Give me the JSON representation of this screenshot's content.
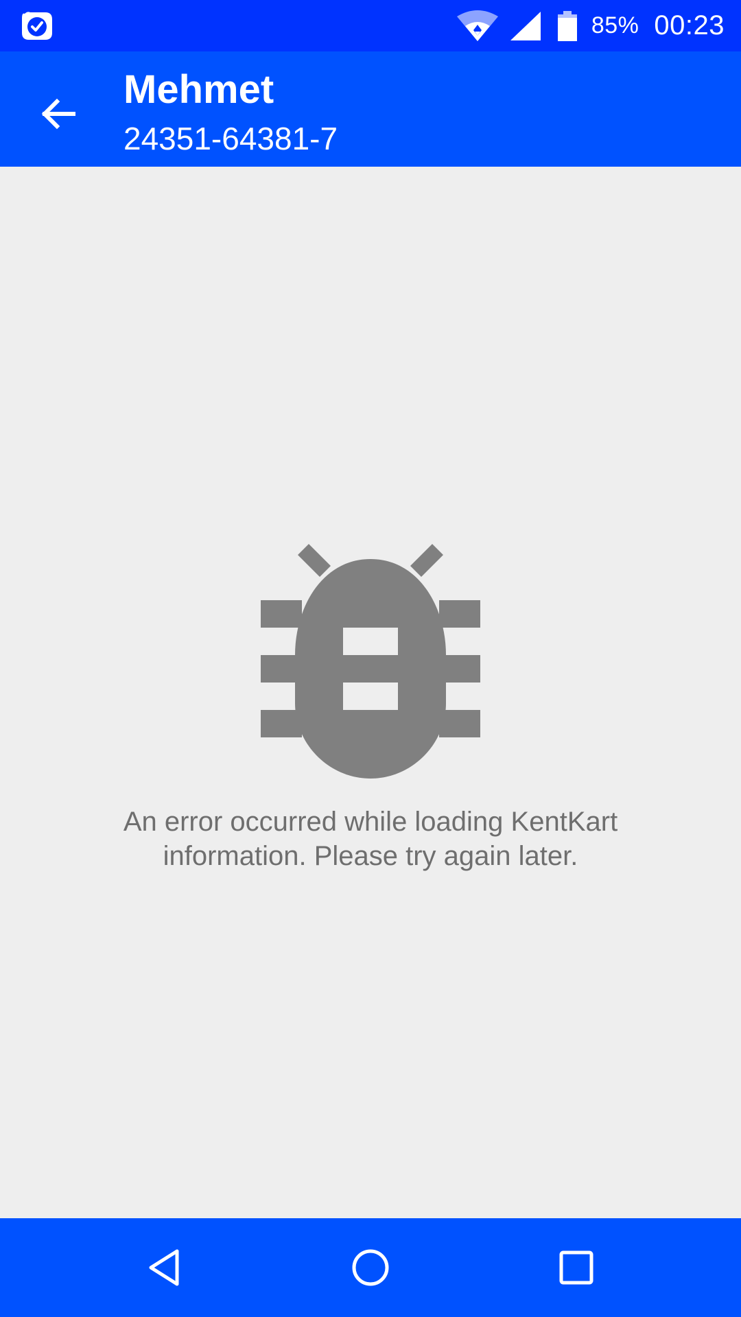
{
  "status_bar": {
    "battery_percent": "85%",
    "time": "00:23",
    "icons": [
      "app-notification-icon",
      "wifi-icon",
      "cell-signal-icon",
      "battery-icon"
    ]
  },
  "app_bar": {
    "title": "Mehmet",
    "subtitle": "24351-64381-7",
    "back_icon": "arrow-back-icon"
  },
  "content": {
    "error_icon": "bug-icon",
    "error_message": "An error occurred while loading KentKart information. Please try again later."
  },
  "nav_bar": {
    "buttons": [
      "back-triangle-icon",
      "home-circle-icon",
      "recents-square-icon"
    ]
  },
  "colors": {
    "status_bar": "#0033ff",
    "app_bar": "#0052ff",
    "background": "#eeeeee",
    "icon_gray": "#808080",
    "text_gray": "#6e6e6e"
  }
}
